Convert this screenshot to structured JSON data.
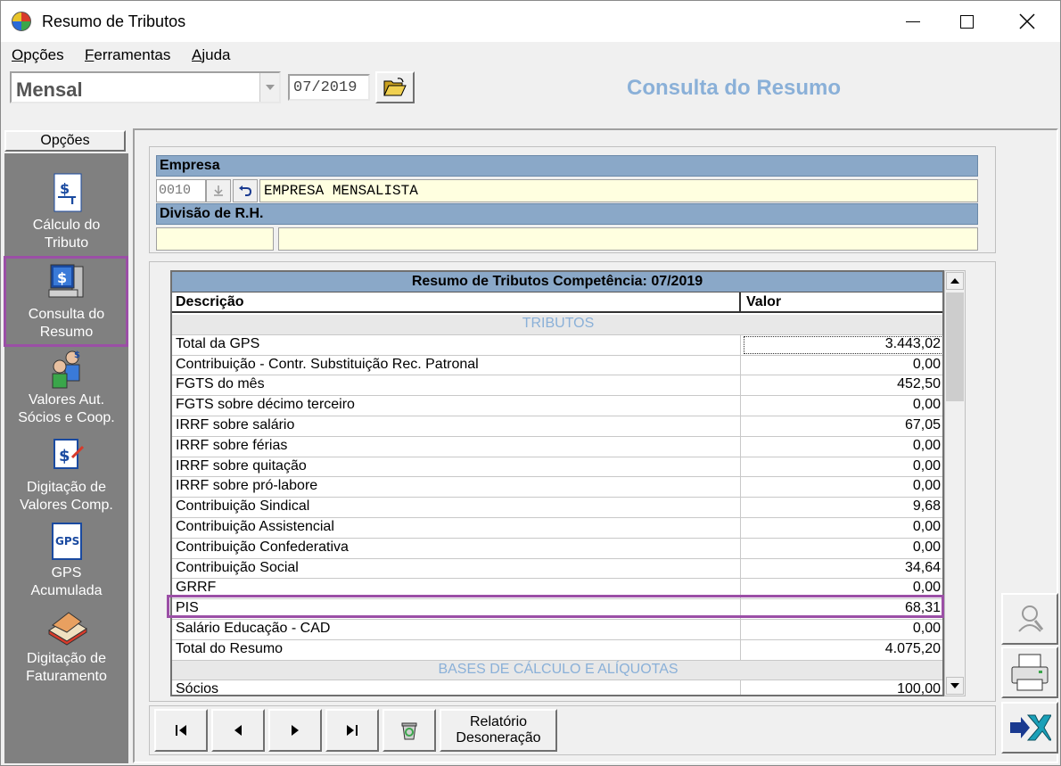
{
  "window": {
    "title": "Resumo de Tributos"
  },
  "menu": [
    {
      "mnemonic": "O",
      "rest": "pções"
    },
    {
      "mnemonic": "F",
      "rest": "erramentas"
    },
    {
      "mnemonic": "A",
      "rest": "juda"
    }
  ],
  "toolbar": {
    "period_type": "Mensal",
    "competencia": "07/2019",
    "header_title": "Consulta do Resumo"
  },
  "sidebar": {
    "header": "Opções",
    "items": [
      {
        "line1": "Cálculo do",
        "line2": "Tributo",
        "icon": "calculation-icon"
      },
      {
        "line1": "Consulta do",
        "line2": "Resumo",
        "icon": "computer-query-icon"
      },
      {
        "line1": "Valores Aut.",
        "line2": "Sócios e  Coop.",
        "icon": "partners-icon"
      },
      {
        "line1": "Digitação de",
        "line2": "Valores Comp.",
        "icon": "edit-values-icon"
      },
      {
        "line1": "GPS",
        "line2": "Acumulada",
        "icon": "gps-icon"
      },
      {
        "line1": "Digitação de",
        "line2": "Faturamento",
        "icon": "billing-book-icon"
      }
    ]
  },
  "empresa": {
    "label": "Empresa",
    "code": "0010",
    "name": "EMPRESA MENSALISTA",
    "divisao_label": "Divisão de R.H."
  },
  "grid": {
    "title": "Resumo de Tributos Competência: 07/2019",
    "col_desc": "Descrição",
    "col_val": "Valor",
    "rows": [
      {
        "desc": "TRIBUTOS",
        "val": "",
        "section": true
      },
      {
        "desc": "Total da GPS",
        "val": "3.443,02"
      },
      {
        "desc": "Contribuição - Contr. Substituição Rec. Patronal",
        "val": "0,00"
      },
      {
        "desc": "FGTS do mês",
        "val": "452,50"
      },
      {
        "desc": "FGTS sobre décimo terceiro",
        "val": "0,00"
      },
      {
        "desc": "IRRF sobre salário",
        "val": "67,05"
      },
      {
        "desc": "IRRF sobre férias",
        "val": "0,00"
      },
      {
        "desc": "IRRF sobre quitação",
        "val": "0,00"
      },
      {
        "desc": "IRRF sobre pró-labore",
        "val": "0,00"
      },
      {
        "desc": "Contribuição Sindical",
        "val": "9,68"
      },
      {
        "desc": "Contribuição Assistencial",
        "val": "0,00"
      },
      {
        "desc": "Contribuição Confederativa",
        "val": "0,00"
      },
      {
        "desc": "Contribuição Social",
        "val": "34,64"
      },
      {
        "desc": "GRRF",
        "val": "0,00"
      },
      {
        "desc": "PIS",
        "val": "68,31"
      },
      {
        "desc": "Salário Educação - CAD",
        "val": "0,00"
      },
      {
        "desc": "Total do Resumo",
        "val": "4.075,20"
      },
      {
        "desc": "BASES DE CÁLCULO E ALÍQUOTAS",
        "val": "",
        "section": true
      },
      {
        "desc": "Sócios",
        "val": "100,00"
      }
    ]
  },
  "bottom": {
    "relatorio_line1": "Relatório",
    "relatorio_line2": "Desoneração"
  },
  "colors": {
    "accent": "#8ab0d8",
    "section_header": "#8aa8c8",
    "highlight": "#9b4fa6",
    "sidebar": "#808080",
    "field_yellow": "#ffffe0"
  }
}
